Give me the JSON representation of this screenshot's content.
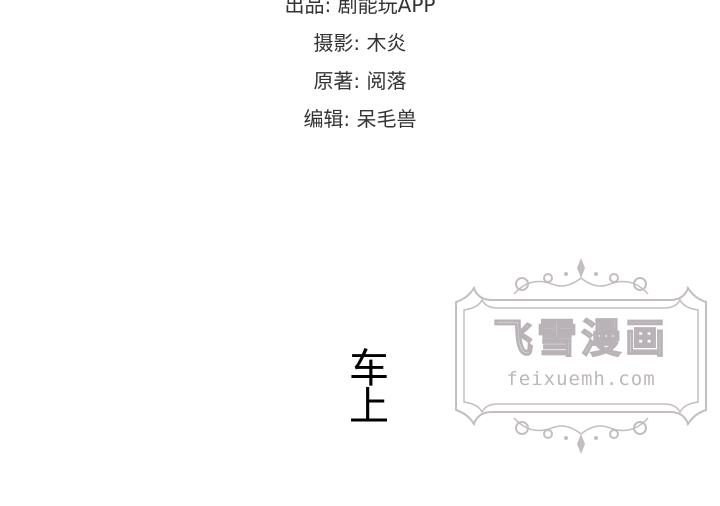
{
  "credits": [
    "出品: 剧能玩APP",
    "摄影: 木炎",
    "原著: 阅落",
    "编辑: 呆毛兽"
  ],
  "chapter_title": [
    "车",
    "上"
  ],
  "watermark": {
    "title": "飞雪漫画",
    "url": "feixuemh.com",
    "color": "#b9b3b7"
  }
}
